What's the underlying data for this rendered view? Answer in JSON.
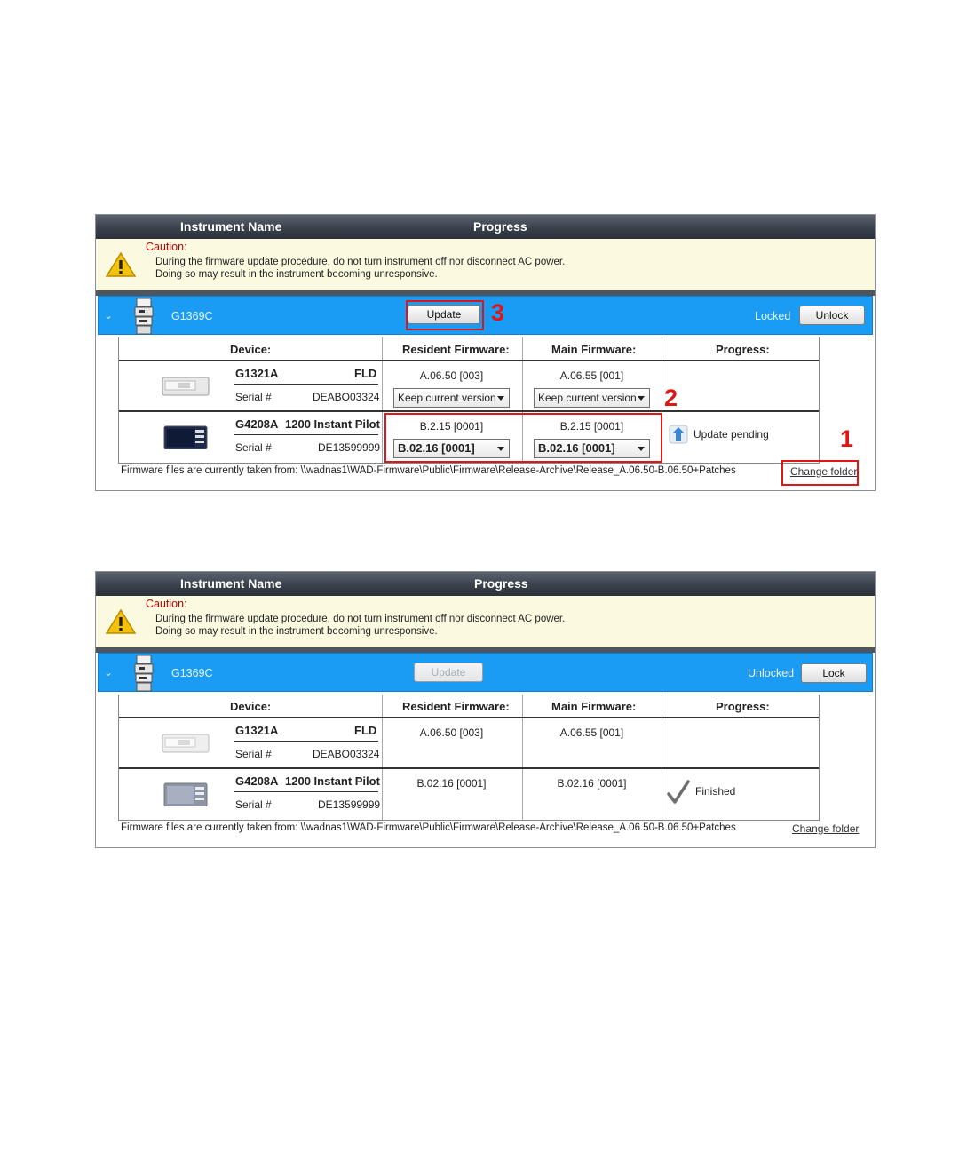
{
  "header": {
    "col_instrument": "Instrument Name",
    "col_progress": "Progress"
  },
  "caution": {
    "title": "Caution:",
    "line1": "During the firmware update procedure, do not turn instrument off nor disconnect AC power.",
    "line2": "Doing so may result in the instrument becoming unresponsive."
  },
  "table_headers": {
    "device": "Device:",
    "resident": "Resident Firmware:",
    "main": "Main Firmware:",
    "progress": "Progress:"
  },
  "serial_label": "Serial #",
  "footer": {
    "path_text": "Firmware files are currently taken from: \\\\wadnas1\\WAD-Firmware\\Public\\Firmware\\Release-Archive\\Release_A.06.50-B.06.50+Patches",
    "change_folder": "Change folder"
  },
  "annotations": {
    "n1": "1",
    "n2": "2",
    "n3": "3"
  },
  "panel1": {
    "instrument": "G1369C",
    "update_label": "Update",
    "update_enabled": true,
    "lock_status": "Locked",
    "lock_button": "Unlock",
    "devices": [
      {
        "model": "G1321A",
        "type": "FLD",
        "serial": "DEABO03324",
        "resident_fw": "A.06.50 [003]",
        "resident_select": "Keep current version",
        "main_fw": "A.06.55 [001]",
        "main_select": "Keep current version",
        "progress": ""
      },
      {
        "model": "G4208A",
        "type": "1200 Instant Pilot",
        "serial": "DE13599999",
        "resident_fw": "B.2.15 [0001]",
        "resident_select": "B.02.16 [0001]",
        "main_fw": "B.2.15 [0001]",
        "main_select": "B.02.16 [0001]",
        "progress": "Update pending"
      }
    ]
  },
  "panel2": {
    "instrument": "G1369C",
    "update_label": "Update",
    "update_enabled": false,
    "lock_status": "Unlocked",
    "lock_button": "Lock",
    "devices": [
      {
        "model": "G1321A",
        "type": "FLD",
        "serial": "DEABO03324",
        "resident_fw": "A.06.50 [003]",
        "main_fw": "A.06.55 [001]",
        "progress": ""
      },
      {
        "model": "G4208A",
        "type": "1200 Instant Pilot",
        "serial": "DE13599999",
        "resident_fw": "B.02.16 [0001]",
        "main_fw": "B.02.16 [0001]",
        "progress": "Finished"
      }
    ]
  },
  "colors": {
    "instrument_bar": "#1a9cf5",
    "annotation_red": "#e01515",
    "caution_bg": "#fbfae0"
  }
}
